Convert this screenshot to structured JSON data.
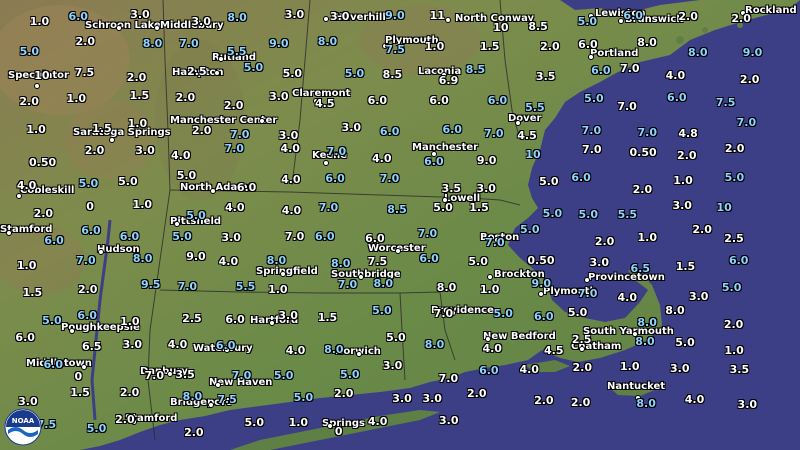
{
  "colors": {
    "ocean": "#3d3f86",
    "land": "#6d8a4a",
    "value_white": "#ffffff",
    "value_blue": "#8fd3ff"
  },
  "logo_icon": "noaa-logo",
  "logo_text": "NOAA",
  "cities": [
    "Schroon Lake",
    "Middlebury",
    "Haverhill",
    "North Conway",
    "Lewiston",
    "Brunswick",
    "Rockland",
    "Speculator",
    "Rutland",
    "Hampton",
    "Plymouth",
    "Laconia",
    "Portland",
    "Claremont",
    "Saratoga Springs",
    "Manchester Center",
    "Keene",
    "Manchester",
    "Dover",
    "Cobleskill",
    "North Adams",
    "Lowell",
    "Stamford",
    "Pittsfield",
    "Hudson",
    "Worcester",
    "Boston",
    "Springfield",
    "Southbridge",
    "Brockton",
    "Provincetown",
    "Plymouth",
    "Hartford",
    "Poughkeepsie",
    "Providence",
    "Waterbury",
    "Norwich",
    "New Bedford",
    "South Yarmouth",
    "Chatham",
    "Middletown",
    "Danbury",
    "New Haven",
    "Bridgeport",
    "Nantucket",
    "Stamford",
    "Springs"
  ],
  "values": [
    "1.0",
    "6.0",
    "3.0",
    "3.0",
    "8.0",
    "3.0",
    "3.0",
    "9.0",
    "11",
    "10",
    "8.5",
    "5.0",
    "6.0",
    "2.0",
    "2.0",
    "5.0",
    "2.0",
    "8.0",
    "7.0",
    "5.5",
    "9.0",
    "8.0",
    "7.5",
    "1.0",
    "1.5",
    "2.0",
    "6.0",
    "8.0",
    "8.0",
    "9.0",
    "10",
    "7.5",
    "2.0",
    "2.5",
    "5.0",
    "5.0",
    "5.0",
    "8.5",
    "6.9",
    "8.5",
    "3.5",
    "6.0",
    "7.0",
    "4.0",
    "2.0",
    "2.0",
    "1.0",
    "1.5",
    "2.0",
    "2.0",
    "3.0",
    "4.5",
    "6.0",
    "6.0",
    "6.0",
    "5.5",
    "5.0",
    "7.0",
    "6.0",
    "7.5",
    "1.0",
    "1.5",
    "1.0",
    "2.0",
    "7.0",
    "3.0",
    "3.0",
    "6.0",
    "6.0",
    "7.0",
    "4.5",
    "7.0",
    "7.0",
    "4.8",
    "7.0",
    "0.50",
    "2.0",
    "3.0",
    "4.0",
    "7.0",
    "4.0",
    "7.0",
    "4.0",
    "6.0",
    "9.0",
    "10",
    "7.0",
    "0.50",
    "2.0",
    "2.0",
    "4.0",
    "5.0",
    "5.0",
    "5.0",
    "6.0",
    "4.0",
    "6.0",
    "7.0",
    "3.5",
    "3.0",
    "5.0",
    "6.0",
    "2.0",
    "1.0",
    "5.0",
    "2.0",
    "0",
    "1.0",
    "5.0",
    "4.0",
    "4.0",
    "7.0",
    "8.5",
    "5.0",
    "1.5",
    "5.0",
    "5.0",
    "5.5",
    "3.0",
    "10",
    "6.0",
    "6.0",
    "6.0",
    "5.0",
    "3.0",
    "7.0",
    "6.0",
    "6.0",
    "7.0",
    "7.0",
    "5.0",
    "2.0",
    "1.0",
    "2.0",
    "2.5",
    "1.0",
    "7.0",
    "8.0",
    "9.0",
    "4.0",
    "8.0",
    "8.0",
    "7.5",
    "6.0",
    "5.0",
    "0.50",
    "3.0",
    "6.5",
    "1.5",
    "6.0",
    "1.5",
    "2.0",
    "9.5",
    "7.0",
    "5.5",
    "1.0",
    "7.0",
    "8.0",
    "8.0",
    "1.0",
    "9.0",
    "7.0",
    "4.0",
    "3.0",
    "5.0",
    "5.0",
    "6.0",
    "1.0",
    "2.5",
    "6.0",
    "3.0",
    "1.5",
    "5.0",
    "7.0",
    "5.0",
    "6.0",
    "5.0",
    "8.0",
    "8.0",
    "2.0",
    "6.0",
    "6.5",
    "3.0",
    "4.0",
    "6.0",
    "4.0",
    "8.0",
    "5.0",
    "8.0",
    "4.0",
    "4.5",
    "2.5",
    "8.0",
    "5.0",
    "1.0",
    "6.0",
    "0",
    "7.0",
    "3.5",
    "7.0",
    "5.0",
    "5.0",
    "3.0",
    "7.0",
    "6.0",
    "4.0",
    "2.0",
    "1.0",
    "3.0",
    "3.5",
    "3.0",
    "1.5",
    "2.0",
    "8.0",
    "7.5",
    "5.0",
    "2.0",
    "3.0",
    "3.0",
    "2.0",
    "2.0",
    "2.0",
    "8.0",
    "4.0",
    "3.0",
    "7.5",
    "5.0",
    "2.0",
    "2.0",
    "5.0",
    "1.0",
    "0",
    "4.0",
    "3.0"
  ]
}
